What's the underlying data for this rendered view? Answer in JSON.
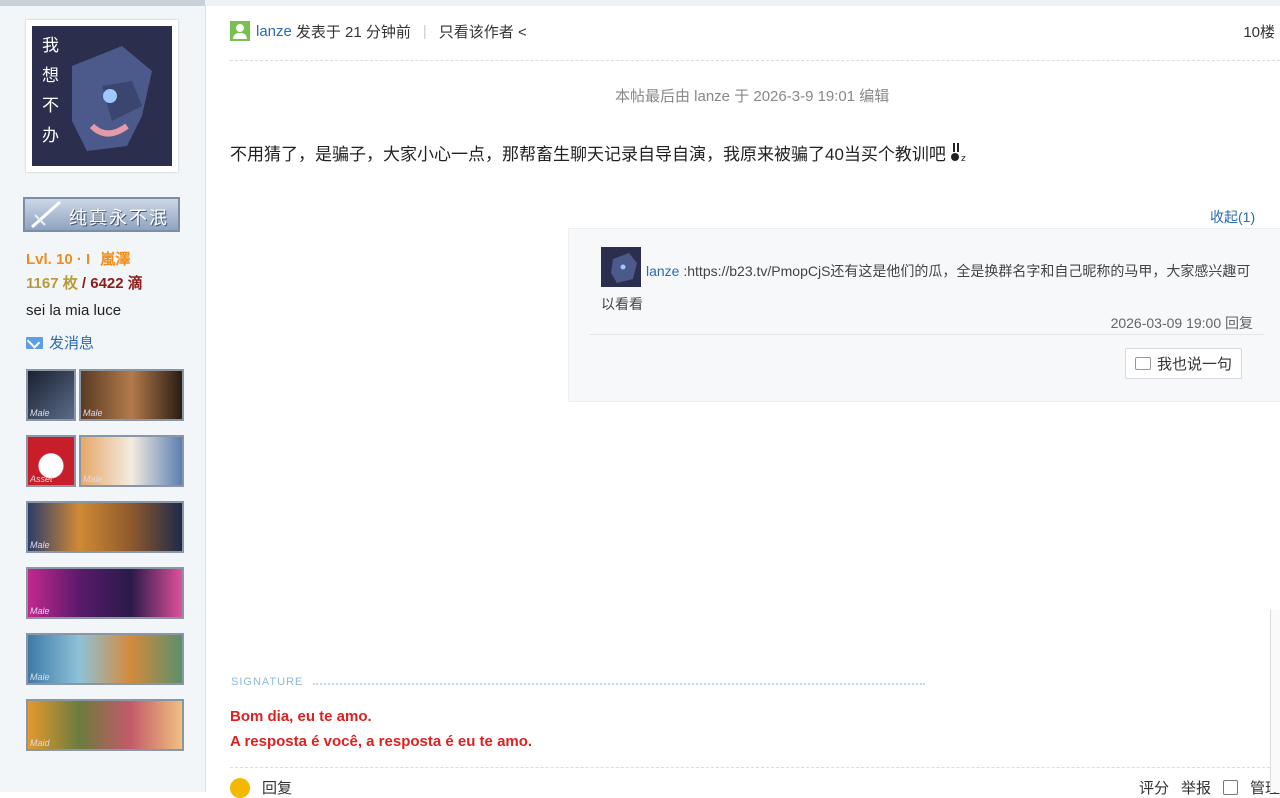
{
  "sidebar": {
    "avatar_alt": "avatar",
    "rank_title": "纯真永不泯",
    "level": "Lvl. 10 · I",
    "level_suffix": "嵐澤",
    "coins": "1167 枚",
    "coins_sep": " / ",
    "drops": "6422 滴",
    "motto": "sei la mia luce",
    "send_message": "发消息",
    "medals": [
      {
        "label": "Male"
      },
      {
        "label": "Male"
      },
      {
        "label": "Asset"
      },
      {
        "label": "Male"
      },
      {
        "label": "Male"
      },
      {
        "label": "Male"
      },
      {
        "label": "Male"
      },
      {
        "label": "Maid"
      }
    ]
  },
  "post": {
    "author": "lanze",
    "posted_at": "发表于 21 分钟前",
    "only_author": "只看该作者 <",
    "floor": "10楼",
    "edit_note": "本帖最后由 lanze 于 2026-3-9 19:01 编辑",
    "content": "不用猜了，是骗子，大家小心一点，那帮畜生聊天记录自导自演，我原来被骗了40当买个教训吧"
  },
  "comments": {
    "collapse_label": "收起(1)",
    "items": [
      {
        "author": "lanze",
        "text": ":https://b23.tv/PmopCjS还有这是他们的瓜，全是换群名字和自己昵称的马甲，大家感兴趣可以看看",
        "time": "2026-03-09 19:00",
        "reply": "回复"
      }
    ],
    "add_comment": "我也说一句"
  },
  "signature": {
    "label": "SIGNATURE",
    "line1": "Bom dia, eu te amo.",
    "line2": "A resposta é você, a resposta é eu te amo."
  },
  "actions": {
    "reply": "回复",
    "rate": "评分",
    "report": "举报",
    "manage": "管理"
  },
  "colors": {
    "link": "#2a6bb3",
    "signature": "#e01f1f",
    "level": "#f08c1a"
  }
}
